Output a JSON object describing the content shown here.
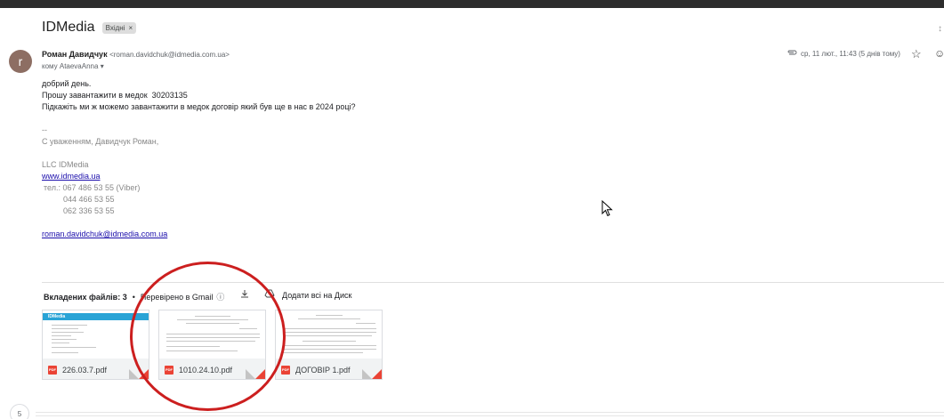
{
  "subject": {
    "title": "IDMedia",
    "label": "Вхідні",
    "label_close": "×"
  },
  "edge": {
    "top_right": "↕",
    "mid_right": "⋮"
  },
  "sender": {
    "avatar_letter": "r",
    "name": "Роман Давидчук",
    "email": "<roman.davidchuk@idmedia.com.ua>",
    "recipient": "кому AtaevaAnna",
    "recipient_caret": "▾",
    "date": "ср, 11 лют., 11:43 (5 днів тому)"
  },
  "icons": {
    "attachment": "paperclip-icon",
    "star": "star-icon",
    "emoji": "emoji-icon",
    "download": "download-icon",
    "drive": "drive-icon"
  },
  "body_lines": {
    "l1": "добрий день.",
    "l2": "Прошу завантажити в медок  30203135",
    "l3": "Підкажіть ми ж можемо завантажити в медок договір який був ще в нас в 2024 році?",
    "sig_sep": "--",
    "sig_greeting": "С уваженням, Давидчук Роман,",
    "company": "LLC IDMedia",
    "website": "www.idmedia.ua",
    "tel1": "тел.: 067 486 53 55 (Viber)",
    "tel2": "044 466 53 55",
    "tel3": "062 336 53 55",
    "email_link": "roman.davidchuk@idmedia.com.ua"
  },
  "attachments": {
    "count_label": "Вкладених файлів: 3",
    "dot": "•",
    "checked_label": "Перевірено в Gmail",
    "info": "ⓘ",
    "add_to_drive": "Додати всі на Диск",
    "pdf_badge": "PDF",
    "files": [
      {
        "name": "226.03.7.pdf"
      },
      {
        "name": "1010.24.10.pdf"
      },
      {
        "name": "ДОГОВІР 1.pdf"
      }
    ],
    "thumb_logo": "IDMedia"
  },
  "page_bubble": "5"
}
